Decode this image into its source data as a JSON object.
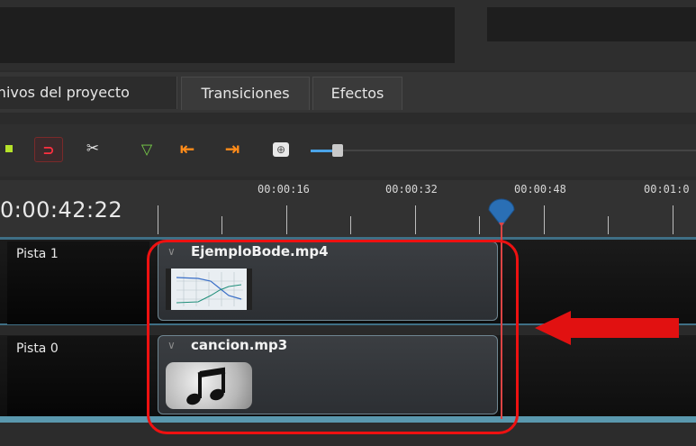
{
  "tabs": [
    {
      "label": "chivos del proyecto"
    },
    {
      "label": "Transiciones"
    },
    {
      "label": "Efectos"
    }
  ],
  "toolbar": {
    "icons": [
      "add-track-icon",
      "snap-magnet-icon",
      "razor-icon",
      "add-marker-icon",
      "previous-marker-icon",
      "next-marker-icon",
      "zoom-in-icon",
      "zoom-slider"
    ],
    "snap_glyph": "⊃",
    "razor_glyph": "✂",
    "marker_glyph": "▽",
    "prev_glyph": "⇤",
    "next_glyph": "⇥",
    "zoomin_glyph": "⊕"
  },
  "ruler": {
    "timecode": "0:00:42:22",
    "labels": [
      "00:00:16",
      "00:00:32",
      "00:00:48",
      "00:01:0"
    ]
  },
  "tracks": [
    {
      "name": "Pista 1",
      "clip": {
        "title": "EjemploBode.mp4",
        "thumbnail": "video-thumbnail"
      }
    },
    {
      "name": "Pista 0",
      "clip": {
        "title": "cancion.mp3",
        "thumbnail": "music-note-icon"
      }
    }
  ],
  "clip_arrow_glyph": "∨",
  "colors": {
    "playhead": "#2a6fb5",
    "annotation": "#e11111",
    "track_separator": "#3f6f85"
  }
}
